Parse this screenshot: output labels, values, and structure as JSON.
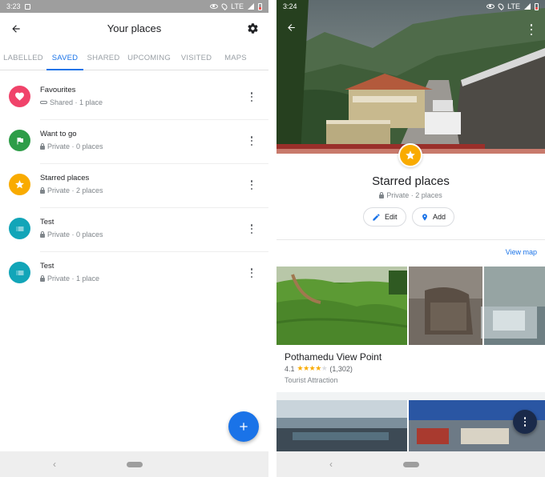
{
  "left_screen": {
    "status_bar": {
      "time": "3:23",
      "network": "LTE"
    },
    "header": {
      "title": "Your places"
    },
    "tabs": [
      {
        "label": "LABELLED",
        "active": false
      },
      {
        "label": "SAVED",
        "active": true
      },
      {
        "label": "SHARED",
        "active": false
      },
      {
        "label": "UPCOMING",
        "active": false
      },
      {
        "label": "VISITED",
        "active": false
      },
      {
        "label": "MAPS",
        "active": false
      }
    ],
    "lists": [
      {
        "name": "Favourites",
        "meta": "Shared · 1 place",
        "icon": "heart-icon",
        "color": "#f0436a",
        "privacy": "shared"
      },
      {
        "name": "Want to go",
        "meta": "Private · 0 places",
        "icon": "flag-icon",
        "color": "#2e9d48",
        "privacy": "private"
      },
      {
        "name": "Starred places",
        "meta": "Private · 2 places",
        "icon": "star-icon",
        "color": "#f9ab00",
        "privacy": "private"
      },
      {
        "name": "Test",
        "meta": "Private · 0 places",
        "icon": "list-icon",
        "color": "#12a5b8",
        "privacy": "private"
      },
      {
        "name": "Test",
        "meta": "Private · 1 place",
        "icon": "list-icon",
        "color": "#12a5b8",
        "privacy": "private"
      }
    ],
    "fab": {
      "icon": "plus-icon",
      "color": "#1a73e8"
    }
  },
  "right_screen": {
    "status_bar": {
      "time": "3:24",
      "network": "LTE"
    },
    "list_title": "Starred places",
    "list_meta": "Private · 2 places",
    "actions": {
      "edit_label": "Edit",
      "add_label": "Add"
    },
    "view_map_label": "View map",
    "place": {
      "name": "Pothamedu View Point",
      "rating": "4.1",
      "stars": 4.1,
      "reviews": "(1,302)",
      "type": "Tourist Attraction"
    },
    "accent_color": "#1a73e8",
    "star_color": "#f9ab00"
  }
}
